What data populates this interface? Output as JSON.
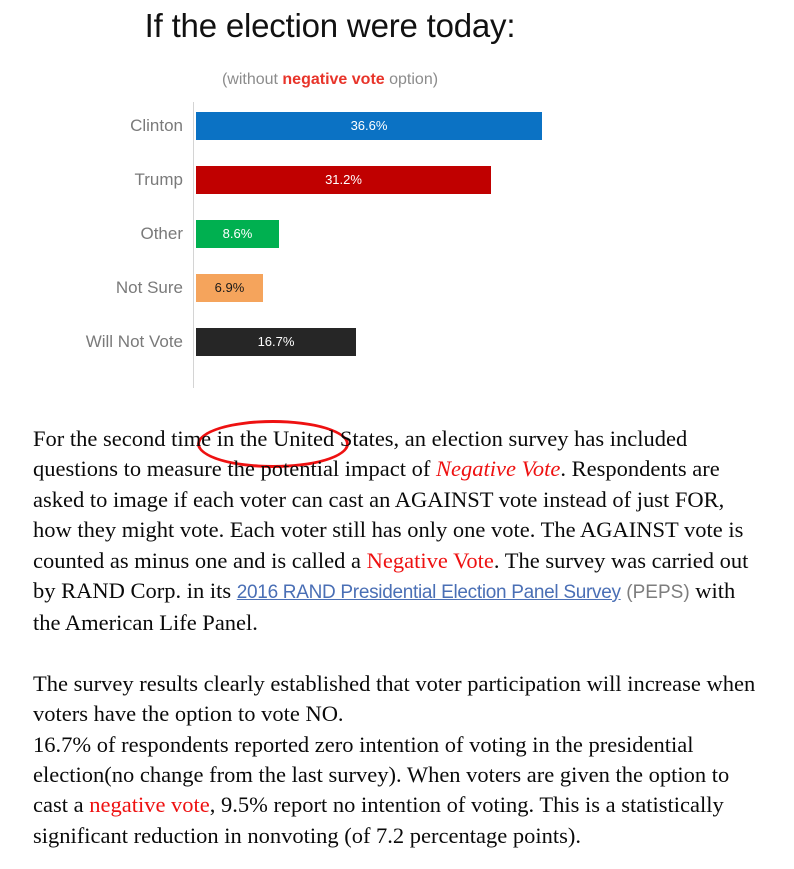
{
  "chart": {
    "title": "If the election were today:",
    "subtitle": {
      "prefix": "(without ",
      "highlight": "negative vote",
      "suffix": " option)"
    },
    "highlight_note": "red-ellipse-around-will-not-vote"
  },
  "chart_data": {
    "type": "bar",
    "orientation": "horizontal",
    "title": "If the election were today:",
    "subtitle": "(without negative vote option)",
    "xlabel": "",
    "ylabel": "",
    "grid": false,
    "legend": "none",
    "xlim": [
      0,
      42
    ],
    "categories": [
      "Clinton",
      "Trump",
      "Other",
      "Not Sure",
      "Will Not Vote"
    ],
    "values": [
      36.6,
      31.2,
      8.6,
      6.9,
      16.7
    ],
    "value_labels": [
      "36.6%",
      "31.2%",
      "8.6%",
      "6.9%",
      "16.7%"
    ],
    "colors": [
      "#0b72c4",
      "#c00000",
      "#00b050",
      "#f5a45c",
      "#262626"
    ],
    "label_colors": [
      "#ffffff",
      "#ffffff",
      "#ffffff",
      "#1a1a1a",
      "#ffffff"
    ],
    "annotations": [
      {
        "type": "ellipse",
        "target_category": "Will Not Vote",
        "color": "#ee1111"
      }
    ]
  },
  "body": {
    "paragraph1": {
      "s1": "For the second time in the United States, an election survey has included questions to measure the potential impact of ",
      "r1": "Negative Vote",
      "s2": ".  Respondents are asked to image if each voter can cast an AGAINST vote instead of just FOR, how they might vote.  Each voter still has only one vote.  The AGAINST vote is counted as minus one and is called a ",
      "r2": "Negative Vote",
      "s3": ".  The survey was carried out by RAND Corp. in its ",
      "link": "2016 RAND Presidential Election Panel Survey",
      "s4": " ",
      "peps": "(PEPS)",
      "s5": " with the American Life Panel."
    },
    "paragraph2": {
      "s1": "The survey results clearly established that voter participation will increase when voters have the option to vote NO.",
      "s2": "16.7% of respondents reported zero intention of voting in the presidential election(no change from the last survey).  When voters are given the option to cast a ",
      "r1": "negative vote",
      "s3": ", 9.5% report no intention of voting.  This is a statistically significant reduction in nonvoting (of 7.2 percentage points)."
    }
  }
}
